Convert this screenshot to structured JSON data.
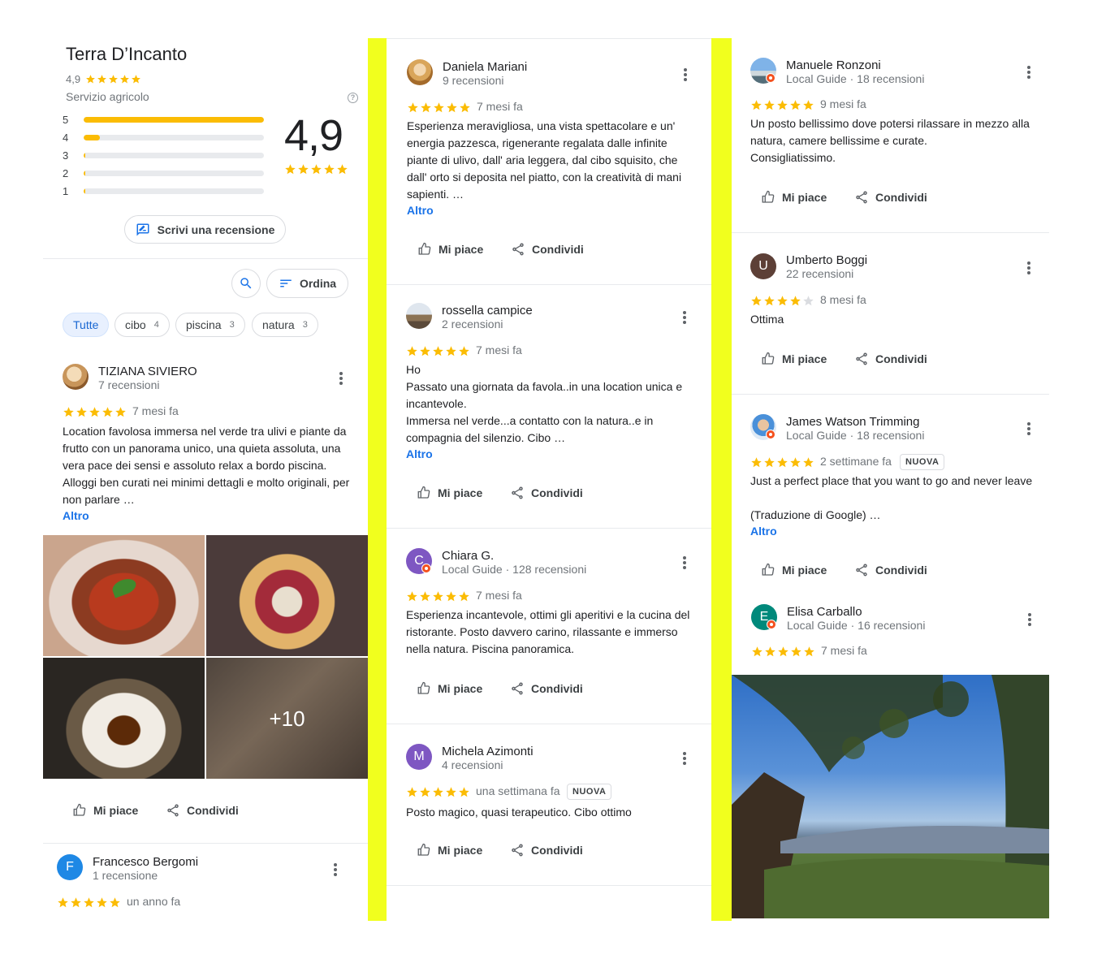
{
  "place": {
    "title": "Terra D’Incanto",
    "rating_small": "4,9",
    "category": "Servizio agricolo",
    "rating_big": "4,9",
    "histogram": [
      {
        "label": "5",
        "fraction": 1.0
      },
      {
        "label": "4",
        "fraction": 0.09
      },
      {
        "label": "3",
        "fraction": 0.01
      },
      {
        "label": "2",
        "fraction": 0.01
      },
      {
        "label": "1",
        "fraction": 0.01
      }
    ],
    "write_review": "Scrivi una recensione",
    "sort_label": "Ordina"
  },
  "filters": [
    {
      "label": "Tutte",
      "count": ""
    },
    {
      "label": "cibo",
      "count": "4"
    },
    {
      "label": "piscina",
      "count": "3"
    },
    {
      "label": "natura",
      "count": "3"
    }
  ],
  "photo_overlay": "+10",
  "actions": {
    "like": "Mi piace",
    "share": "Condividi",
    "more": "Altro"
  },
  "reviews": [
    {
      "name": "TIZIANA SIVIERO",
      "sub": "7 recensioni",
      "stars": 5,
      "date": "7 mesi fa",
      "text": "Location favolosa immersa nel verde tra ulivi e piante da frutto con un panorama unico, una quieta assoluta, una vera pace dei sensi e assoluto relax a bordo piscina. Alloggi ben curati nei minimi dettagli e molto originali, per non parlare …"
    },
    {
      "name": "Francesco Bergomi",
      "sub": "1 recensione",
      "stars": 5,
      "date": "un anno fa",
      "avatar_letter": "F"
    },
    {
      "name": "Daniela Mariani",
      "sub": "9 recensioni",
      "stars": 5,
      "date": "7 mesi fa",
      "text": "Esperienza meravigliosa, una vista spettacolare e un' energia pazzesca, rigenerante regalata dalle infinite piante di ulivo, dall' aria leggera, dal cibo squisito, che dall' orto si deposita nel piatto, con la creatività di mani sapienti. …"
    },
    {
      "name": "rossella campice",
      "sub": "2 recensioni",
      "stars": 5,
      "date": "7 mesi fa",
      "text": "Ho\nPassato una giornata da favola..in una location unica e incantevole.\nImmersa nel verde...a contatto con la natura..e  in compagnia del silenzio. Cibo …"
    },
    {
      "name": "Chiara G.",
      "sub": "Local Guide · 128 recensioni",
      "stars": 5,
      "date": "7 mesi fa",
      "avatar_letter": "C",
      "text": "Esperienza incantevole, ottimi gli aperitivi e la cucina del ristorante. Posto davvero carino, rilassante e immerso nella natura. Piscina panoramica."
    },
    {
      "name": "Michela Azimonti",
      "sub": "4 recensioni",
      "stars": 5,
      "date": "una settimana fa",
      "badge": "NUOVA",
      "avatar_letter": "M",
      "text": "Posto magico, quasi terapeutico. Cibo ottimo"
    },
    {
      "name": "Manuele Ronzoni",
      "sub": "Local Guide · 18 recensioni",
      "stars": 5,
      "date": "9 mesi fa",
      "text": "Un posto bellissimo dove potersi rilassare in mezzo alla natura, camere bellissime e curate.\nConsigliatissimo."
    },
    {
      "name": "Umberto Boggi",
      "sub": "22 recensioni",
      "stars": 4,
      "date": "8 mesi fa",
      "avatar_letter": "U",
      "text": "Ottima"
    },
    {
      "name": "James Watson Trimming",
      "sub": "Local Guide · 18 recensioni",
      "stars": 5,
      "date": "2 settimane fa",
      "badge": "NUOVA",
      "text": "Just a perfect place that you want to go and never leave\n\n(Traduzione di Google) …"
    },
    {
      "name": "Elisa Carballo",
      "sub": "Local Guide · 16 recensioni",
      "stars": 5,
      "date": "7 mesi fa",
      "avatar_letter": "E"
    }
  ],
  "colors": {
    "star": "#fbbc04",
    "link": "#1a73e8",
    "highlight": "#f1ff1e"
  }
}
